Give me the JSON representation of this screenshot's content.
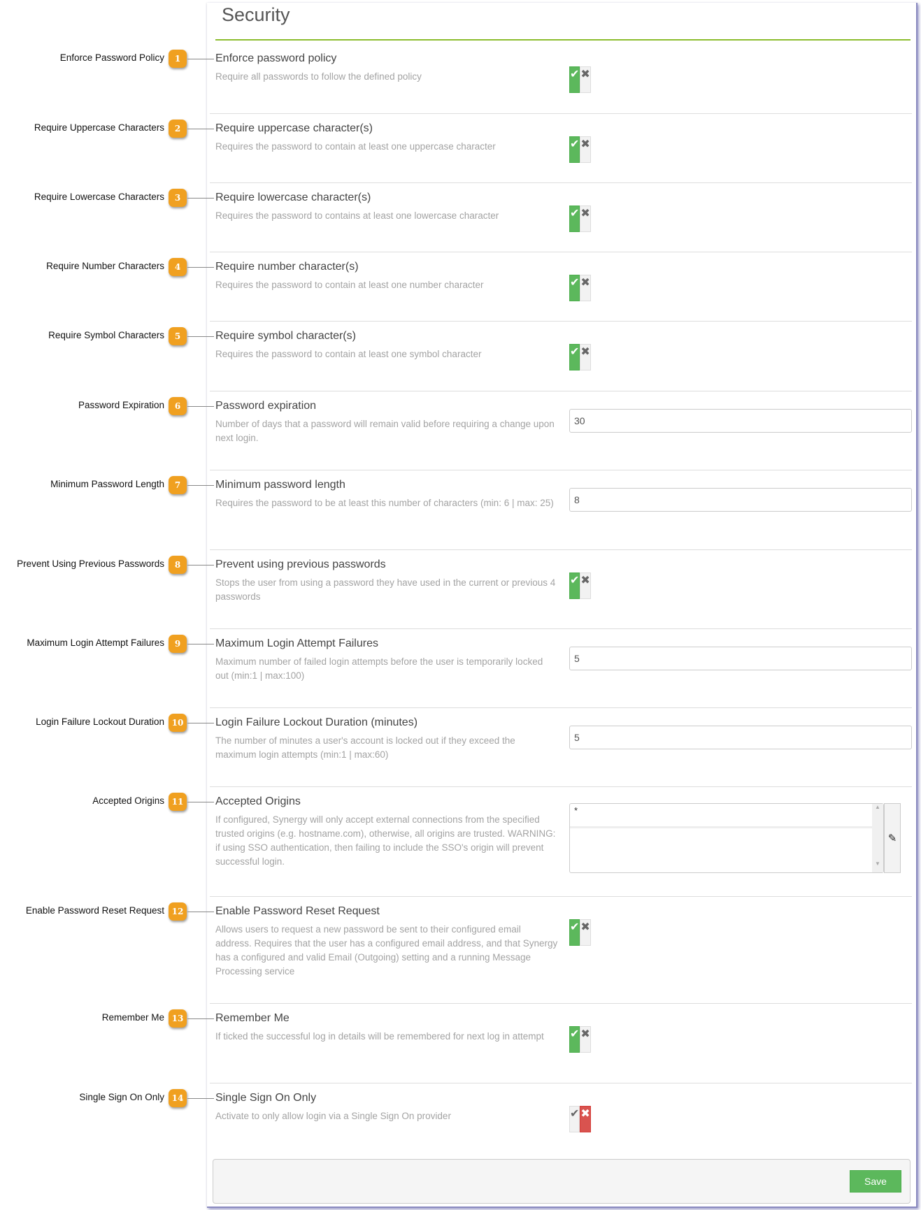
{
  "panel": {
    "title": "Security",
    "save_label": "Save",
    "accent": "#8cbd2f",
    "toggle_on_color": "#5cb85c",
    "toggle_off_color": "#d9534f",
    "badge_color": "#f0a020"
  },
  "rows": [
    {
      "num": "1",
      "label": "Enforce Password Policy",
      "title": "Enforce password policy",
      "desc": "Require all passwords to follow the defined policy",
      "type": "toggle",
      "value": true
    },
    {
      "num": "2",
      "label": "Require Uppercase Characters",
      "title": "Require uppercase character(s)",
      "desc": "Requires the password to contain at least one uppercase character",
      "type": "toggle",
      "value": true
    },
    {
      "num": "3",
      "label": "Require Lowercase Characters",
      "title": "Require lowercase character(s)",
      "desc": "Requires the password to contains at least one lowercase character",
      "type": "toggle",
      "value": true
    },
    {
      "num": "4",
      "label": "Require Number Characters",
      "title": "Require number character(s)",
      "desc": "Requires the password to contain at least one number character",
      "type": "toggle",
      "value": true
    },
    {
      "num": "5",
      "label": "Require Symbol Characters",
      "title": "Require symbol character(s)",
      "desc": "Requires the password to contain at least one symbol character",
      "type": "toggle",
      "value": true
    },
    {
      "num": "6",
      "label": "Password Expiration",
      "title": "Password expiration",
      "desc": "Number of days that a password will remain valid before requiring a change upon next login.",
      "type": "input",
      "value": "30"
    },
    {
      "num": "7",
      "label": "Minimum Password Length",
      "title": "Minimum password length",
      "desc": "Requires the password to be at least this number of characters (min: 6 | max: 25)",
      "type": "input",
      "value": "8"
    },
    {
      "num": "8",
      "label": "Prevent Using Previous Passwords",
      "title": "Prevent using previous passwords",
      "desc": "Stops the user from using a password they have used in the current or previous 4 passwords",
      "type": "toggle",
      "value": true
    },
    {
      "num": "9",
      "label": "Maximum Login Attempt Failures",
      "title": "Maximum Login Attempt Failures",
      "desc": "Maximum number of failed login attempts before the user is temporarily locked out (min:1 | max:100)",
      "type": "input",
      "value": "5"
    },
    {
      "num": "10",
      "label": "Login Failure Lockout Duration",
      "title": "Login Failure Lockout Duration (minutes)",
      "desc": "The number of minutes a user's account is locked out if they exceed the maximum login attempts (min:1 | max:60)",
      "type": "input",
      "value": "5"
    },
    {
      "num": "11",
      "label": "Accepted Origins",
      "title": "Accepted Origins",
      "desc": "If configured, Synergy will only accept external connections from the specified trusted origins (e.g. hostname.com), otherwise, all origins are trusted. WARNING: if using SSO authentication, then failing to include the SSO's origin will prevent successful login.",
      "type": "textarea",
      "value": "*"
    },
    {
      "num": "12",
      "label": "Enable Password Reset Request",
      "title": "Enable Password Reset Request",
      "desc": "Allows users to request a new password be sent to their configured email address. Requires that the user has a configured email address, and that Synergy has a configured and valid Email (Outgoing) setting and a running Message Processing service",
      "type": "toggle",
      "value": true
    },
    {
      "num": "13",
      "label": "Remember Me",
      "title": "Remember Me",
      "desc": "If ticked the successful log in details will be remembered for next log in attempt",
      "type": "toggle",
      "value": true
    },
    {
      "num": "14",
      "label": "Single Sign On Only",
      "title": "Single Sign On Only",
      "desc": "Activate to only allow login via a Single Sign On provider",
      "type": "toggle",
      "value": false
    }
  ]
}
